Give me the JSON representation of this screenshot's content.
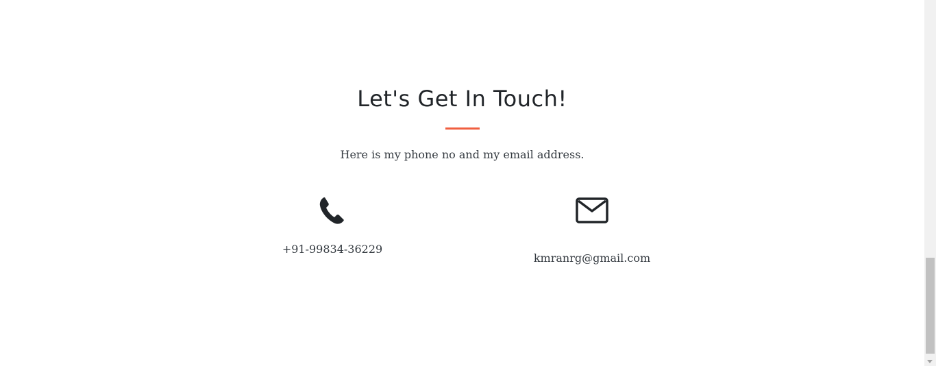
{
  "section": {
    "title": "Let's Get In Touch!",
    "subtitle": "Here is my phone no and my email address.",
    "accent_color": "#f05f40"
  },
  "contacts": {
    "phone": {
      "icon": "phone-icon",
      "text": "+91-99834-36229"
    },
    "email": {
      "icon": "envelope-icon",
      "text": "kmranrg@gmail.com"
    }
  }
}
